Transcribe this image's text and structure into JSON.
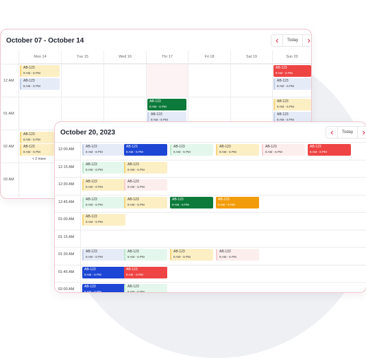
{
  "colors": {
    "accent": "#e0445a",
    "red": "#ee4444",
    "dark_blue": "#1d46d4",
    "dark_green": "#0c7a3a",
    "orange": "#f39c0b",
    "yellow": "#fcefc4",
    "light_blue": "#e6ebf8",
    "light_green": "#e4f7ec",
    "light_pink": "#fdeeee"
  },
  "weekly": {
    "title": "October  07 - October 14",
    "today_label": "Today",
    "days": [
      "Mon 14",
      "Tue 15",
      "Wed 16",
      "Thr 17",
      "Fri 18",
      "Sat 19",
      "Sun 20"
    ],
    "times": [
      "12 AM",
      "01 AM",
      "02 AM",
      "03 AM"
    ],
    "more_label": "+ 2 more",
    "event": {
      "code": "AB-123",
      "time": "9 AM - 6 PM"
    }
  },
  "daily": {
    "title": "October 20, 2023",
    "today_label": "Today",
    "times": [
      "12:00 AM",
      "12:15 AM",
      "12:30 AM",
      "12:45 AM",
      "01:00 AM",
      "01:15 AM",
      "01:30 AM",
      "01:45 AM",
      "02:00 AM"
    ],
    "event": {
      "code": "AB-123",
      "time": "9 AM - 6 PM"
    }
  }
}
